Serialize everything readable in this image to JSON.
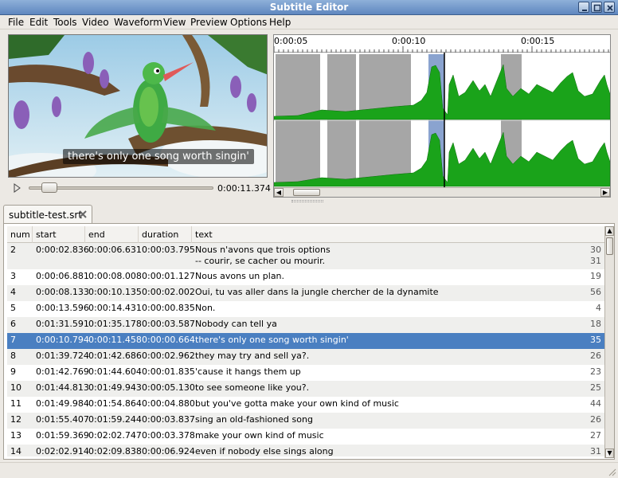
{
  "window": {
    "title": "Subtitle Editor"
  },
  "menu": [
    "File",
    "Edit",
    "Tools",
    "Video",
    "Waveform",
    "View",
    "Preview",
    "Options",
    "Help"
  ],
  "video": {
    "subtitle": "there's only one song worth singin'",
    "timecode": "0:00:11.374"
  },
  "waveform": {
    "ticks": [
      "0:00:05",
      "0:00:10",
      "0:00:15"
    ]
  },
  "tab": {
    "label": "subtitle-test.srt"
  },
  "table": {
    "columns": [
      "num",
      "start",
      "end",
      "duration",
      "text"
    ],
    "rows": [
      {
        "num": "2",
        "start": "0:00:02.836",
        "end": "0:00:06.631",
        "duration": "0:00:03.795",
        "text": "Nous n'avons que trois options",
        "text2": "-- courir, se cacher ou mourir.",
        "count": "30",
        "count2": "31"
      },
      {
        "num": "3",
        "start": "0:00:06.881",
        "end": "0:00:08.008",
        "duration": "0:00:01.127",
        "text": "Nous avons un plan.",
        "count": "19"
      },
      {
        "num": "4",
        "start": "0:00:08.133",
        "end": "0:00:10.135",
        "duration": "0:00:02.002",
        "text": "Oui, tu vas aller dans la jungle chercher de la dynamite",
        "count": "56"
      },
      {
        "num": "5",
        "start": "0:00:13.596",
        "end": "0:00:14.431",
        "duration": "0:00:00.835",
        "text": "Non.",
        "count": "4"
      },
      {
        "num": "6",
        "start": "0:01:31.591",
        "end": "0:01:35.178",
        "duration": "0:00:03.587",
        "text": "Nobody can tell ya",
        "count": "18"
      },
      {
        "num": "7",
        "start": "0:00:10.794",
        "end": "0:00:11.458",
        "duration": "0:00:00.664",
        "text": "there's only one song worth singin'",
        "count": "35"
      },
      {
        "num": "8",
        "start": "0:01:39.724",
        "end": "0:01:42.686",
        "duration": "0:00:02.962",
        "text": "they may try and sell ya?.",
        "count": "26"
      },
      {
        "num": "9",
        "start": "0:01:42.769",
        "end": "0:01:44.604",
        "duration": "0:00:01.835",
        "text": "'cause it hangs them up",
        "count": "23"
      },
      {
        "num": "10",
        "start": "0:01:44.813",
        "end": "0:01:49.943",
        "duration": "0:00:05.130",
        "text": "to see someone like you?.",
        "count": "25"
      },
      {
        "num": "11",
        "start": "0:01:49.984",
        "end": "0:01:54.864",
        "duration": "0:00:04.880",
        "text": "but you've gotta make your own kind of music",
        "count": "44"
      },
      {
        "num": "12",
        "start": "0:01:55.407",
        "end": "0:01:59.244",
        "duration": "0:00:03.837",
        "text": "sing an old-fashioned song",
        "count": "26"
      },
      {
        "num": "13",
        "start": "0:01:59.369",
        "end": "0:02:02.747",
        "duration": "0:00:03.378",
        "text": "make your own kind of music",
        "count": "27"
      },
      {
        "num": "14",
        "start": "0:02:02.914",
        "end": "0:02:09.838",
        "duration": "0:00:06.924",
        "text": "even if nobody else sings along",
        "count": "31"
      }
    ]
  },
  "colors": {
    "selection": "#4a7fc1",
    "waveform": "#1aa31a",
    "region": "#a6a6a6",
    "current_region": "#8aa3cf"
  }
}
